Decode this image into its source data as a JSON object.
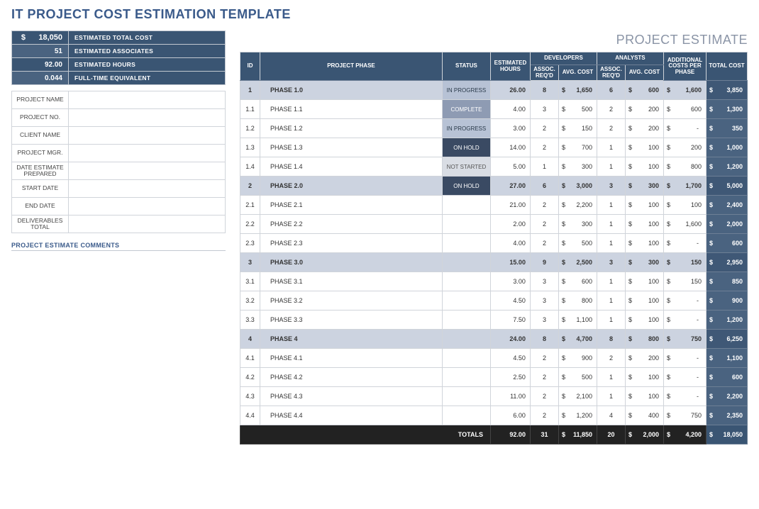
{
  "title": "IT PROJECT COST ESTIMATION TEMPLATE",
  "subheader": "PROJECT ESTIMATE",
  "summary": {
    "total_cost_sym": "$",
    "total_cost": "18,050",
    "total_cost_lbl": "ESTIMATED TOTAL COST",
    "assoc": "51",
    "assoc_lbl": "ESTIMATED ASSOCIATES",
    "hours": "92.00",
    "hours_lbl": "ESTIMATED HOURS",
    "fte": "0.044",
    "fte_lbl": "FULL-TIME EQUIVALENT"
  },
  "meta_labels": {
    "project_name": "PROJECT NAME",
    "project_no": "PROJECT NO.",
    "client_name": "CLIENT NAME",
    "project_mgr": "PROJECT MGR.",
    "date_est": "DATE ESTIMATE PREPARED",
    "start_date": "START DATE",
    "end_date": "END DATE",
    "deliv_total": "DELIVERABLES TOTAL"
  },
  "comments_hdr": "PROJECT ESTIMATE COMMENTS",
  "hdr": {
    "id": "ID",
    "phase": "PROJECT PHASE",
    "status": "STATUS",
    "est_hours": "ESTIMATED HOURS",
    "developers": "DEVELOPERS",
    "analysts": "ANALYSTS",
    "assoc": "ASSOC. REQ'D",
    "avg_cost": "AVG. COST",
    "additional": "ADDITIONAL COSTS PER PHASE",
    "total_cost": "TOTAL COST",
    "totals": "TOTALS"
  },
  "rows": [
    {
      "id": "1",
      "phase": "PHASE 1.0",
      "status": "IN PROGRESS",
      "statusClass": "s-inprogress",
      "hours": "26.00",
      "dev_assoc": "8",
      "dev_cost": "1,650",
      "an_assoc": "6",
      "an_cost": "600",
      "add": "1,600",
      "total": "3,850",
      "parent": true
    },
    {
      "id": "1.1",
      "phase": "PHASE 1.1",
      "status": "COMPLETE",
      "statusClass": "s-complete",
      "hours": "4.00",
      "dev_assoc": "3",
      "dev_cost": "500",
      "an_assoc": "2",
      "an_cost": "200",
      "add": "600",
      "total": "1,300"
    },
    {
      "id": "1.2",
      "phase": "PHASE 1.2",
      "status": "IN PROGRESS",
      "statusClass": "s-inprogress",
      "hours": "3.00",
      "dev_assoc": "2",
      "dev_cost": "150",
      "an_assoc": "2",
      "an_cost": "200",
      "add": "-",
      "total": "350"
    },
    {
      "id": "1.3",
      "phase": "PHASE 1.3",
      "status": "ON HOLD",
      "statusClass": "s-onhold",
      "hours": "14.00",
      "dev_assoc": "2",
      "dev_cost": "700",
      "an_assoc": "1",
      "an_cost": "100",
      "add": "200",
      "total": "1,000"
    },
    {
      "id": "1.4",
      "phase": "PHASE 1.4",
      "status": "NOT STARTED",
      "statusClass": "s-notstarted",
      "hours": "5.00",
      "dev_assoc": "1",
      "dev_cost": "300",
      "an_assoc": "1",
      "an_cost": "100",
      "add": "800",
      "total": "1,200"
    },
    {
      "id": "2",
      "phase": "PHASE 2.0",
      "status": "ON HOLD",
      "statusClass": "s-onhold",
      "hours": "27.00",
      "dev_assoc": "6",
      "dev_cost": "3,000",
      "an_assoc": "3",
      "an_cost": "300",
      "add": "1,700",
      "total": "5,000",
      "parent": true
    },
    {
      "id": "2.1",
      "phase": "PHASE 2.1",
      "status": "",
      "hours": "21.00",
      "dev_assoc": "2",
      "dev_cost": "2,200",
      "an_assoc": "1",
      "an_cost": "100",
      "add": "100",
      "total": "2,400"
    },
    {
      "id": "2.2",
      "phase": "PHASE 2.2",
      "status": "",
      "hours": "2.00",
      "dev_assoc": "2",
      "dev_cost": "300",
      "an_assoc": "1",
      "an_cost": "100",
      "add": "1,600",
      "total": "2,000"
    },
    {
      "id": "2.3",
      "phase": "PHASE 2.3",
      "status": "",
      "hours": "4.00",
      "dev_assoc": "2",
      "dev_cost": "500",
      "an_assoc": "1",
      "an_cost": "100",
      "add": "-",
      "total": "600"
    },
    {
      "id": "3",
      "phase": "PHASE 3.0",
      "status": "",
      "hours": "15.00",
      "dev_assoc": "9",
      "dev_cost": "2,500",
      "an_assoc": "3",
      "an_cost": "300",
      "add": "150",
      "total": "2,950",
      "parent": true
    },
    {
      "id": "3.1",
      "phase": "PHASE 3.1",
      "status": "",
      "hours": "3.00",
      "dev_assoc": "3",
      "dev_cost": "600",
      "an_assoc": "1",
      "an_cost": "100",
      "add": "150",
      "total": "850"
    },
    {
      "id": "3.2",
      "phase": "PHASE 3.2",
      "status": "",
      "hours": "4.50",
      "dev_assoc": "3",
      "dev_cost": "800",
      "an_assoc": "1",
      "an_cost": "100",
      "add": "-",
      "total": "900"
    },
    {
      "id": "3.3",
      "phase": "PHASE 3.3",
      "status": "",
      "hours": "7.50",
      "dev_assoc": "3",
      "dev_cost": "1,100",
      "an_assoc": "1",
      "an_cost": "100",
      "add": "-",
      "total": "1,200"
    },
    {
      "id": "4",
      "phase": "PHASE 4",
      "status": "",
      "hours": "24.00",
      "dev_assoc": "8",
      "dev_cost": "4,700",
      "an_assoc": "8",
      "an_cost": "800",
      "add": "750",
      "total": "6,250",
      "parent": true
    },
    {
      "id": "4.1",
      "phase": "PHASE 4.1",
      "status": "",
      "hours": "4.50",
      "dev_assoc": "2",
      "dev_cost": "900",
      "an_assoc": "2",
      "an_cost": "200",
      "add": "-",
      "total": "1,100"
    },
    {
      "id": "4.2",
      "phase": "PHASE 4.2",
      "status": "",
      "hours": "2.50",
      "dev_assoc": "2",
      "dev_cost": "500",
      "an_assoc": "1",
      "an_cost": "100",
      "add": "-",
      "total": "600"
    },
    {
      "id": "4.3",
      "phase": "PHASE 4.3",
      "status": "",
      "hours": "11.00",
      "dev_assoc": "2",
      "dev_cost": "2,100",
      "an_assoc": "1",
      "an_cost": "100",
      "add": "-",
      "total": "2,200"
    },
    {
      "id": "4.4",
      "phase": "PHASE 4.4",
      "status": "",
      "hours": "6.00",
      "dev_assoc": "2",
      "dev_cost": "1,200",
      "an_assoc": "4",
      "an_cost": "400",
      "add": "750",
      "total": "2,350"
    }
  ],
  "totals": {
    "hours": "92.00",
    "dev_assoc": "31",
    "dev_cost": "11,850",
    "an_assoc": "20",
    "an_cost": "2,000",
    "add": "4,200",
    "total": "18,050"
  }
}
